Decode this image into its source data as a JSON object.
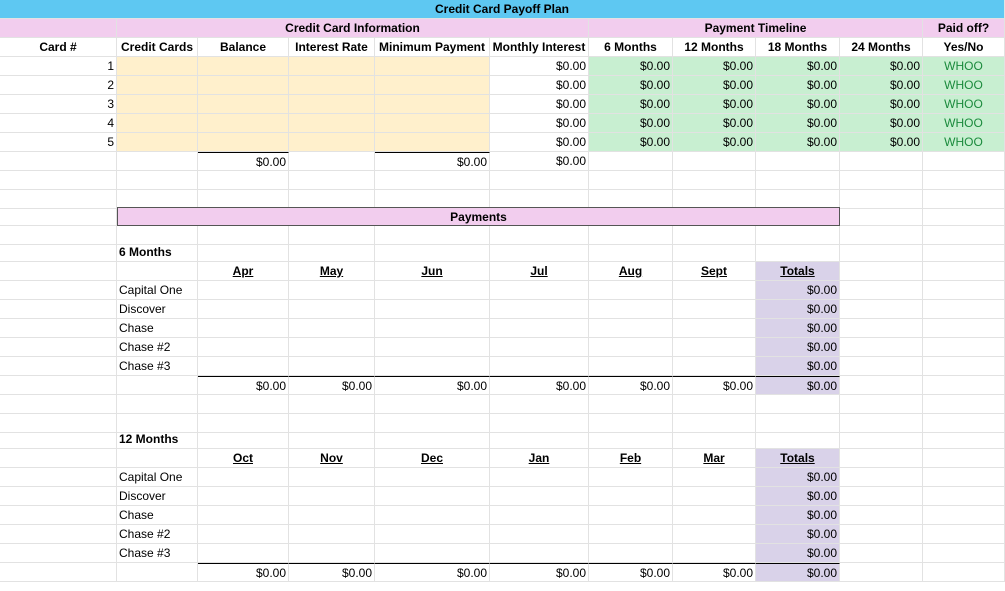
{
  "title": "Credit Card Payoff Plan",
  "groups": {
    "info": "Credit Card Information",
    "timeline": "Payment Timeline",
    "paid": "Paid off?"
  },
  "headers": [
    "Card #",
    "Credit Cards",
    "Balance",
    "Interest Rate",
    "Minimum Payment",
    "Monthly Interest",
    "6 Months",
    "12 Months",
    "18 Months",
    "24 Months",
    "Yes/No"
  ],
  "cards": [
    {
      "num": "1",
      "interest": "$0.00",
      "m6": "$0.00",
      "m12": "$0.00",
      "m18": "$0.00",
      "m24": "$0.00",
      "paid": "WHOO"
    },
    {
      "num": "2",
      "interest": "$0.00",
      "m6": "$0.00",
      "m12": "$0.00",
      "m18": "$0.00",
      "m24": "$0.00",
      "paid": "WHOO"
    },
    {
      "num": "3",
      "interest": "$0.00",
      "m6": "$0.00",
      "m12": "$0.00",
      "m18": "$0.00",
      "m24": "$0.00",
      "paid": "WHOO"
    },
    {
      "num": "4",
      "interest": "$0.00",
      "m6": "$0.00",
      "m12": "$0.00",
      "m18": "$0.00",
      "m24": "$0.00",
      "paid": "WHOO"
    },
    {
      "num": "5",
      "interest": "$0.00",
      "m6": "$0.00",
      "m12": "$0.00",
      "m18": "$0.00",
      "m24": "$0.00",
      "paid": "WHOO"
    }
  ],
  "card_totals": {
    "balance": "$0.00",
    "min_payment": "$0.00",
    "interest": "$0.00"
  },
  "payments_title": "Payments",
  "plans": [
    {
      "label": "6 Months",
      "months": [
        "Apr",
        "May",
        "Jun",
        "Jul",
        "Aug",
        "Sept"
      ],
      "totals_label": "Totals",
      "rows": [
        {
          "name": "Capital One",
          "total": "$0.00"
        },
        {
          "name": "Discover",
          "total": "$0.00"
        },
        {
          "name": "Chase",
          "total": "$0.00"
        },
        {
          "name": "Chase #2",
          "total": "$0.00"
        },
        {
          "name": "Chase #3",
          "total": "$0.00"
        }
      ],
      "month_totals": [
        "$0.00",
        "$0.00",
        "$0.00",
        "$0.00",
        "$0.00",
        "$0.00"
      ],
      "grand_total": "$0.00"
    },
    {
      "label": "12 Months",
      "months": [
        "Oct",
        "Nov",
        "Dec",
        "Jan",
        "Feb",
        "Mar"
      ],
      "totals_label": "Totals",
      "rows": [
        {
          "name": "Capital One",
          "total": "$0.00"
        },
        {
          "name": "Discover",
          "total": "$0.00"
        },
        {
          "name": "Chase",
          "total": "$0.00"
        },
        {
          "name": "Chase #2",
          "total": "$0.00"
        },
        {
          "name": "Chase #3",
          "total": "$0.00"
        }
      ],
      "month_totals": [
        "$0.00",
        "$0.00",
        "$0.00",
        "$0.00",
        "$0.00",
        "$0.00"
      ],
      "grand_total": "$0.00"
    }
  ],
  "colors": {
    "title_bg": "#5ec8f2",
    "header_bg": "#f2cdee",
    "input_bg": "#fff0cc",
    "timeline_bg": "#c8efd1",
    "totals_bg": "#d9d2e9",
    "whoo_text": "#1a8a3c"
  }
}
